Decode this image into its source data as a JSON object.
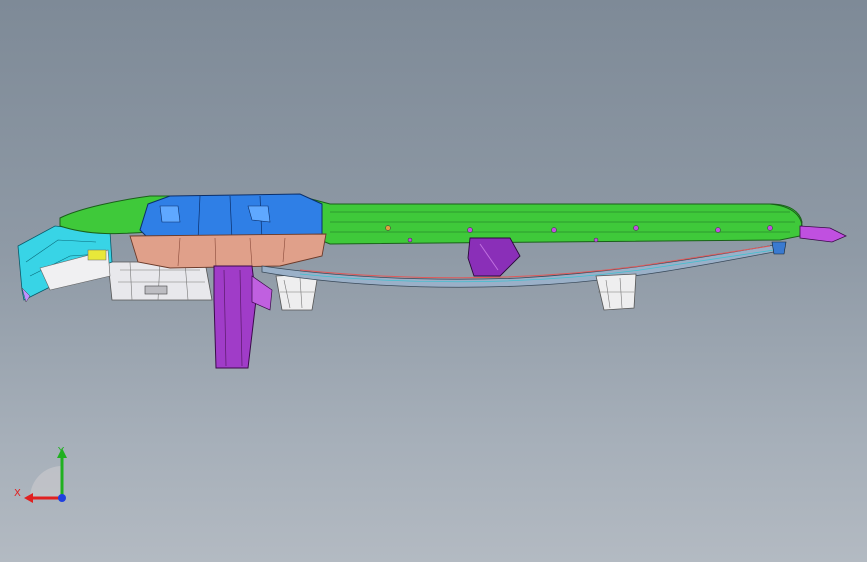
{
  "viewport": {
    "model_name": "dashboard-cross-car-beam-assembly",
    "colors": {
      "bg_top": "#7e8a97",
      "bg_bottom": "#b3bac2",
      "green_beam": "#3fc93a",
      "green_dark": "#1f7f1f",
      "blue_duct": "#2f7fe6",
      "salmon_housing": "#e0a08a",
      "purple_bracket": "#a03cc8",
      "cyan_panel": "#38d4e6",
      "white_parts": "#e6e6ea",
      "yellow_part": "#e8e83a"
    }
  },
  "triad": {
    "x_label": "X",
    "y_label": "Y",
    "x_color": "#e02020",
    "y_color": "#20b020",
    "z_color": "#2040e0"
  }
}
